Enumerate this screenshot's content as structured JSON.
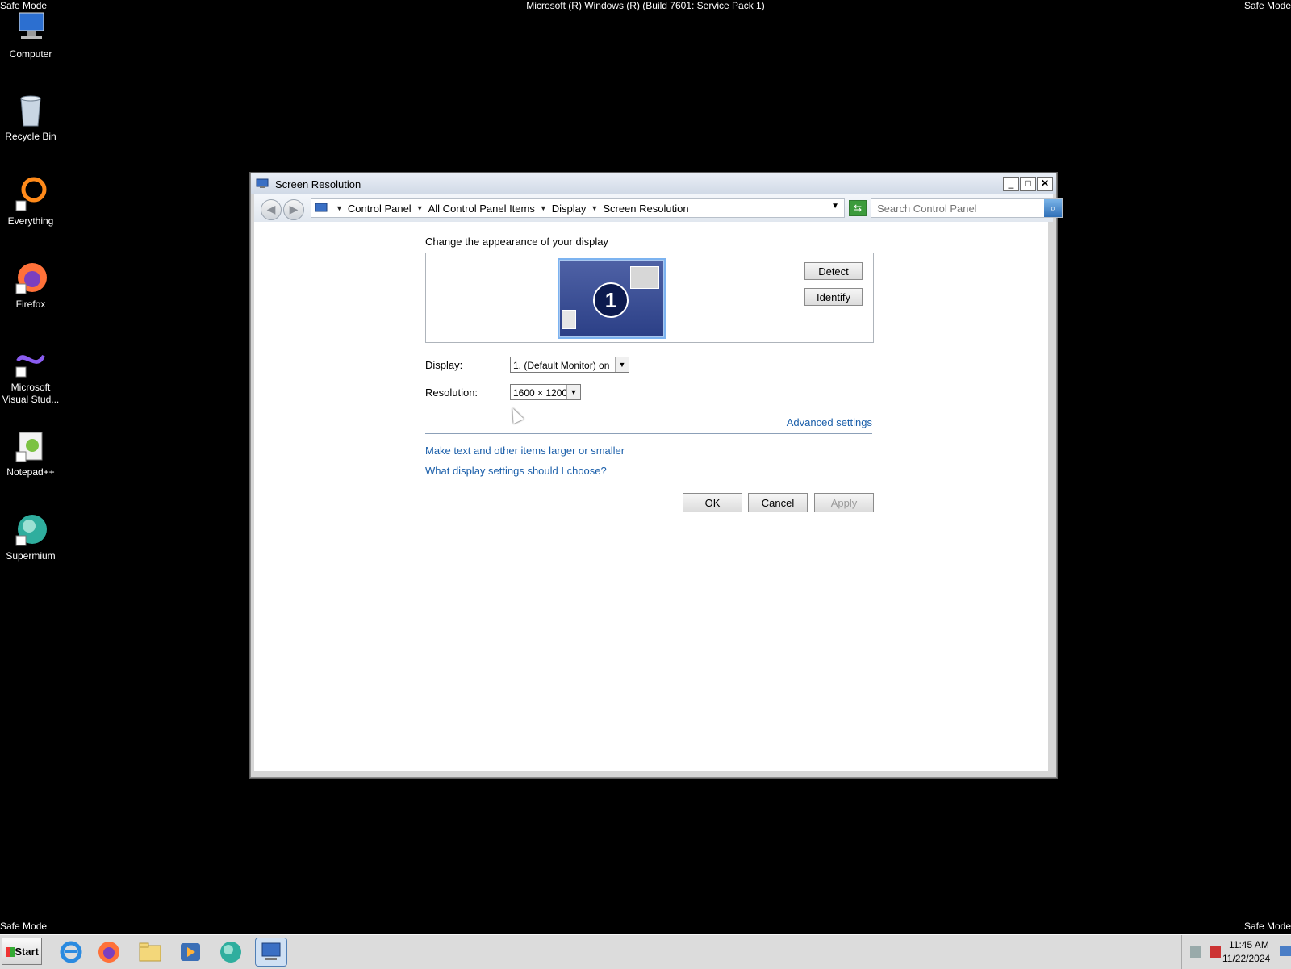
{
  "desktop": {
    "safe_mode_label": "Safe Mode",
    "os_title": "Microsoft (R) Windows (R) (Build 7601: Service Pack 1)",
    "icons": [
      {
        "label": "Computer",
        "icon": "computer-icon"
      },
      {
        "label": "Recycle Bin",
        "icon": "recycle-bin-icon"
      },
      {
        "label": "Everything",
        "icon": "everything-icon"
      },
      {
        "label": "Firefox",
        "icon": "firefox-icon"
      },
      {
        "label": "Microsoft Visual Stud...",
        "icon": "visual-studio-icon"
      },
      {
        "label": "Notepad++",
        "icon": "notepad-plus-plus-icon"
      },
      {
        "label": "Supermium",
        "icon": "supermium-icon"
      }
    ]
  },
  "window": {
    "title": "Screen Resolution",
    "breadcrumb": [
      "Control Panel",
      "All Control Panel Items",
      "Display",
      "Screen Resolution"
    ],
    "search": {
      "placeholder": "Search Control Panel"
    },
    "heading": "Change the appearance of your display",
    "monitor_number": "1",
    "buttons": {
      "detect": "Detect",
      "identify": "Identify",
      "ok": "OK",
      "cancel": "Cancel",
      "apply": "Apply"
    },
    "display": {
      "label": "Display:",
      "value": "1. (Default Monitor) on"
    },
    "resolution": {
      "label": "Resolution:",
      "value": "1600 × 1200"
    },
    "links": {
      "advanced": "Advanced settings",
      "larger": "Make text and other items larger or smaller",
      "help": "What display settings should I choose?"
    }
  },
  "taskbar": {
    "start_label": "Start",
    "apps": [
      "internet-explorer-icon",
      "firefox-icon",
      "file-explorer-icon",
      "media-player-icon",
      "supermium-icon",
      "control-panel-icon"
    ],
    "clock": {
      "time": "11:45 AM",
      "date": "11/22/2024"
    }
  },
  "colors": {
    "accent": "#1b5faa",
    "desktop_bg": "#000000",
    "monitor_tile": "#3a4e96"
  }
}
